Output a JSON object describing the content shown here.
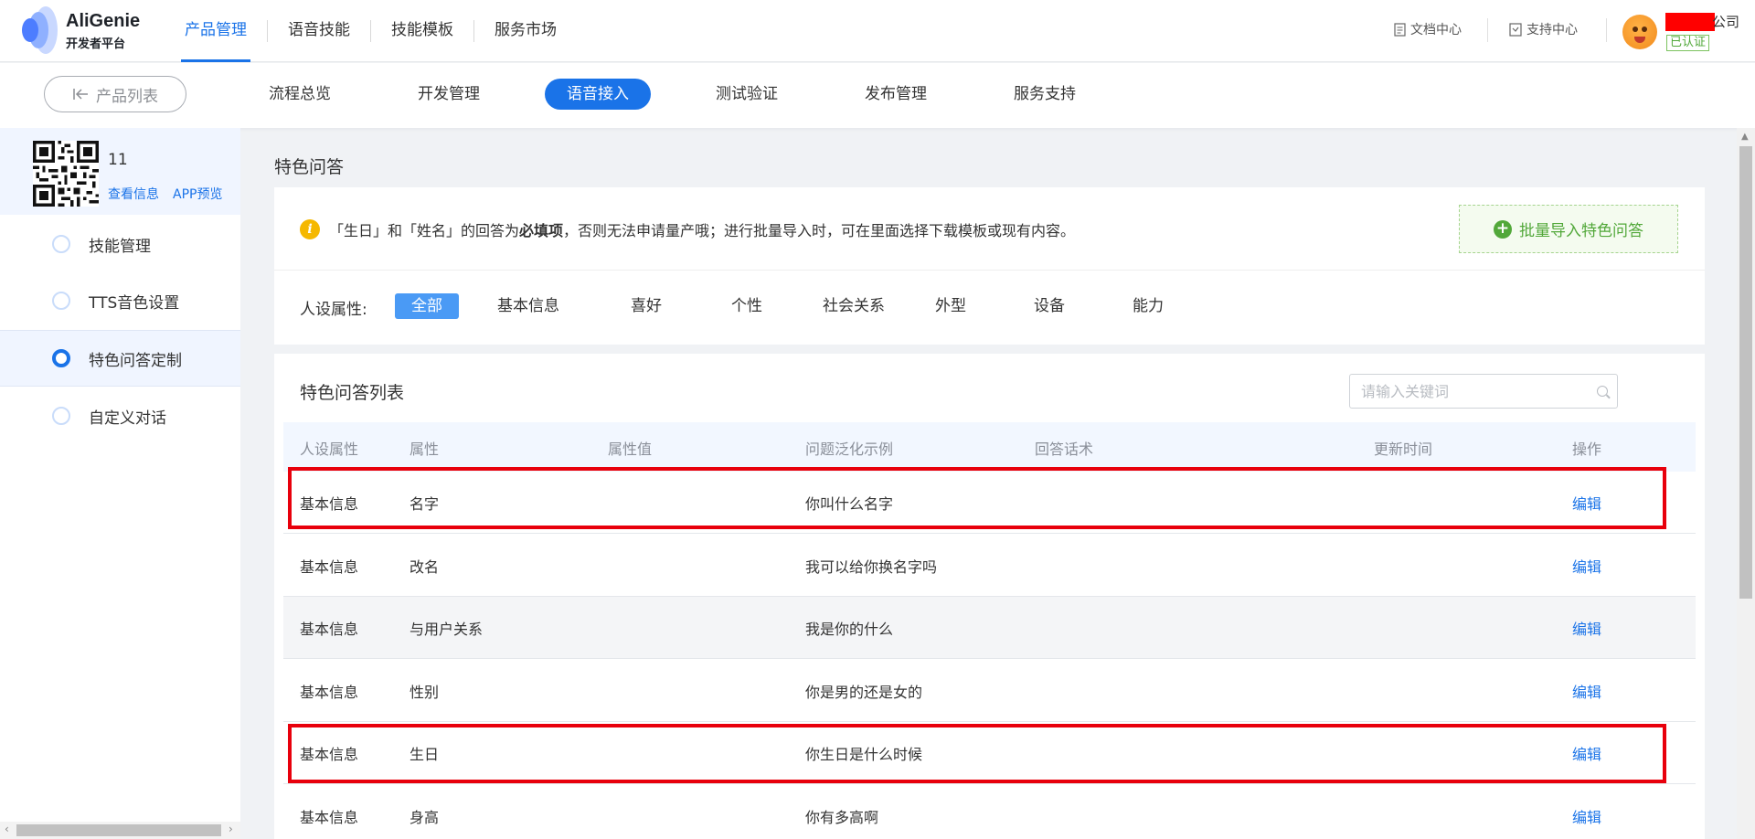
{
  "brand": {
    "name": "AliGenie",
    "subtitle": "开发者平台"
  },
  "top_nav": [
    {
      "label": "产品管理",
      "active": true
    },
    {
      "label": "语音技能"
    },
    {
      "label": "技能模板"
    },
    {
      "label": "服务市场"
    }
  ],
  "top_links": {
    "docs": "文档中心",
    "support": "支持中心"
  },
  "user": {
    "company_suffix": "公司",
    "verified": "已认证"
  },
  "sub_nav": {
    "back": "产品列表",
    "items": [
      "流程总览",
      "开发管理",
      "语音接入",
      "测试验证",
      "发布管理",
      "服务支持"
    ],
    "active": "语音接入"
  },
  "product": {
    "name": "11",
    "view_info": "查看信息",
    "app_preview": "APP预览"
  },
  "sidebar": {
    "items": [
      {
        "label": "技能管理"
      },
      {
        "label": "TTS音色设置"
      },
      {
        "label": "特色问答定制",
        "active": true
      },
      {
        "label": "自定义对话"
      }
    ]
  },
  "page": {
    "title": "特色问答",
    "notice": {
      "before": "「生日」和「姓名」的回答为",
      "bold": "必填项",
      "after": "，否则无法申请量产哦；进行批量导入时，可在里面选择下载模板或现有内容。"
    },
    "import_button": "批量导入特色问答",
    "filter_label": "人设属性:",
    "filters": [
      "全部",
      "基本信息",
      "喜好",
      "个性",
      "社会关系",
      "外型",
      "设备",
      "能力"
    ],
    "active_filter": "全部"
  },
  "list": {
    "title": "特色问答列表",
    "search_placeholder": "请输入关键词",
    "columns": [
      "人设属性",
      "属性",
      "属性值",
      "问题泛化示例",
      "回答话术",
      "更新时间",
      "操作"
    ],
    "rows": [
      {
        "category": "基本信息",
        "attribute": "名字",
        "value": "",
        "example": "你叫什么名字",
        "answer": "",
        "updated": "",
        "action": "编辑",
        "highlighted": true
      },
      {
        "category": "基本信息",
        "attribute": "改名",
        "value": "",
        "example": "我可以给你换名字吗",
        "answer": "",
        "updated": "",
        "action": "编辑"
      },
      {
        "category": "基本信息",
        "attribute": "与用户关系",
        "value": "",
        "example": "我是你的什么",
        "answer": "",
        "updated": "",
        "action": "编辑"
      },
      {
        "category": "基本信息",
        "attribute": "性别",
        "value": "",
        "example": "你是男的还是女的",
        "answer": "",
        "updated": "",
        "action": "编辑"
      },
      {
        "category": "基本信息",
        "attribute": "生日",
        "value": "",
        "example": "你生日是什么时候",
        "answer": "",
        "updated": "",
        "action": "编辑",
        "highlighted": true
      },
      {
        "category": "基本信息",
        "attribute": "身高",
        "value": "",
        "example": "你有多高啊",
        "answer": "",
        "updated": "",
        "action": "编辑"
      }
    ]
  },
  "colors": {
    "primary": "#1a73e8",
    "success": "#52a83a",
    "highlight": "#e8000c",
    "warning": "#f5b800"
  }
}
